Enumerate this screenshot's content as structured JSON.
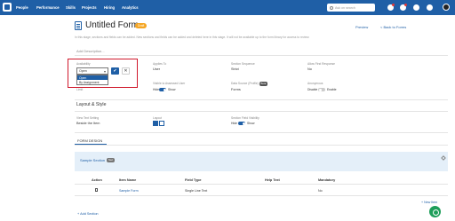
{
  "nav": {
    "items": [
      "People",
      "Performance",
      "Skills",
      "Projects",
      "Hiring",
      "Analytics"
    ],
    "search_placeholder": "Ask on search"
  },
  "header": {
    "title": "Untitled Form",
    "status": "Draft",
    "preview": "Preview",
    "back": "< Back to Forms",
    "help": "In this stage, sections and fields can be added. New sections and fields can be added and deleted here in this stage. It will not be available up to the form library for access to review.",
    "description_placeholder": "Add Description..."
  },
  "settings": {
    "availability_label": "Availability",
    "availability_value": "Open",
    "availability_options": [
      "Open",
      "By Assignment"
    ],
    "applies_to_label": "Applies To",
    "applies_to_value": "User",
    "section_sequence_label": "Section Sequence",
    "section_sequence_value": "Strict",
    "allow_response_label": "Allow First Response",
    "allow_response_value": "No",
    "limit_value": "Limit",
    "visible_label": "Visible to Assessed User",
    "visible_hide": "Hide",
    "visible_show": "Show",
    "data_source_label": "Data Source (Profile)",
    "data_source_badge": "Beta",
    "data_source_value": "Forms",
    "anonymous_label": "Anonymous",
    "anonymous_disable": "Disable",
    "anonymous_enable": "Enable"
  },
  "layout": {
    "heading": "Layout & Style",
    "view_label": "View Text Setting",
    "view_value": "Beside the Item",
    "layout_label": "Layout",
    "visibility_label": "Section Field Visibility",
    "visibility_hide": "Hide",
    "visibility_show": "Show"
  },
  "tabs": {
    "form_design": "FORM DESIGN"
  },
  "section": {
    "name": "Sample Section",
    "tag": "Sec"
  },
  "table": {
    "headers": [
      "Action",
      "Item Name",
      "Field Type",
      "Help Text",
      "Mandatory"
    ],
    "rows": [
      {
        "item_name": "Sample Form",
        "field_type": "Single Line Text",
        "help_text": "",
        "mandatory": "No"
      }
    ],
    "new_item": "+ New Item"
  },
  "footer": {
    "add_section": "+ Add Section"
  },
  "colors": {
    "brand": "#1f5fa6",
    "highlight": "#d0192c",
    "chat": "#1e9e5a"
  }
}
